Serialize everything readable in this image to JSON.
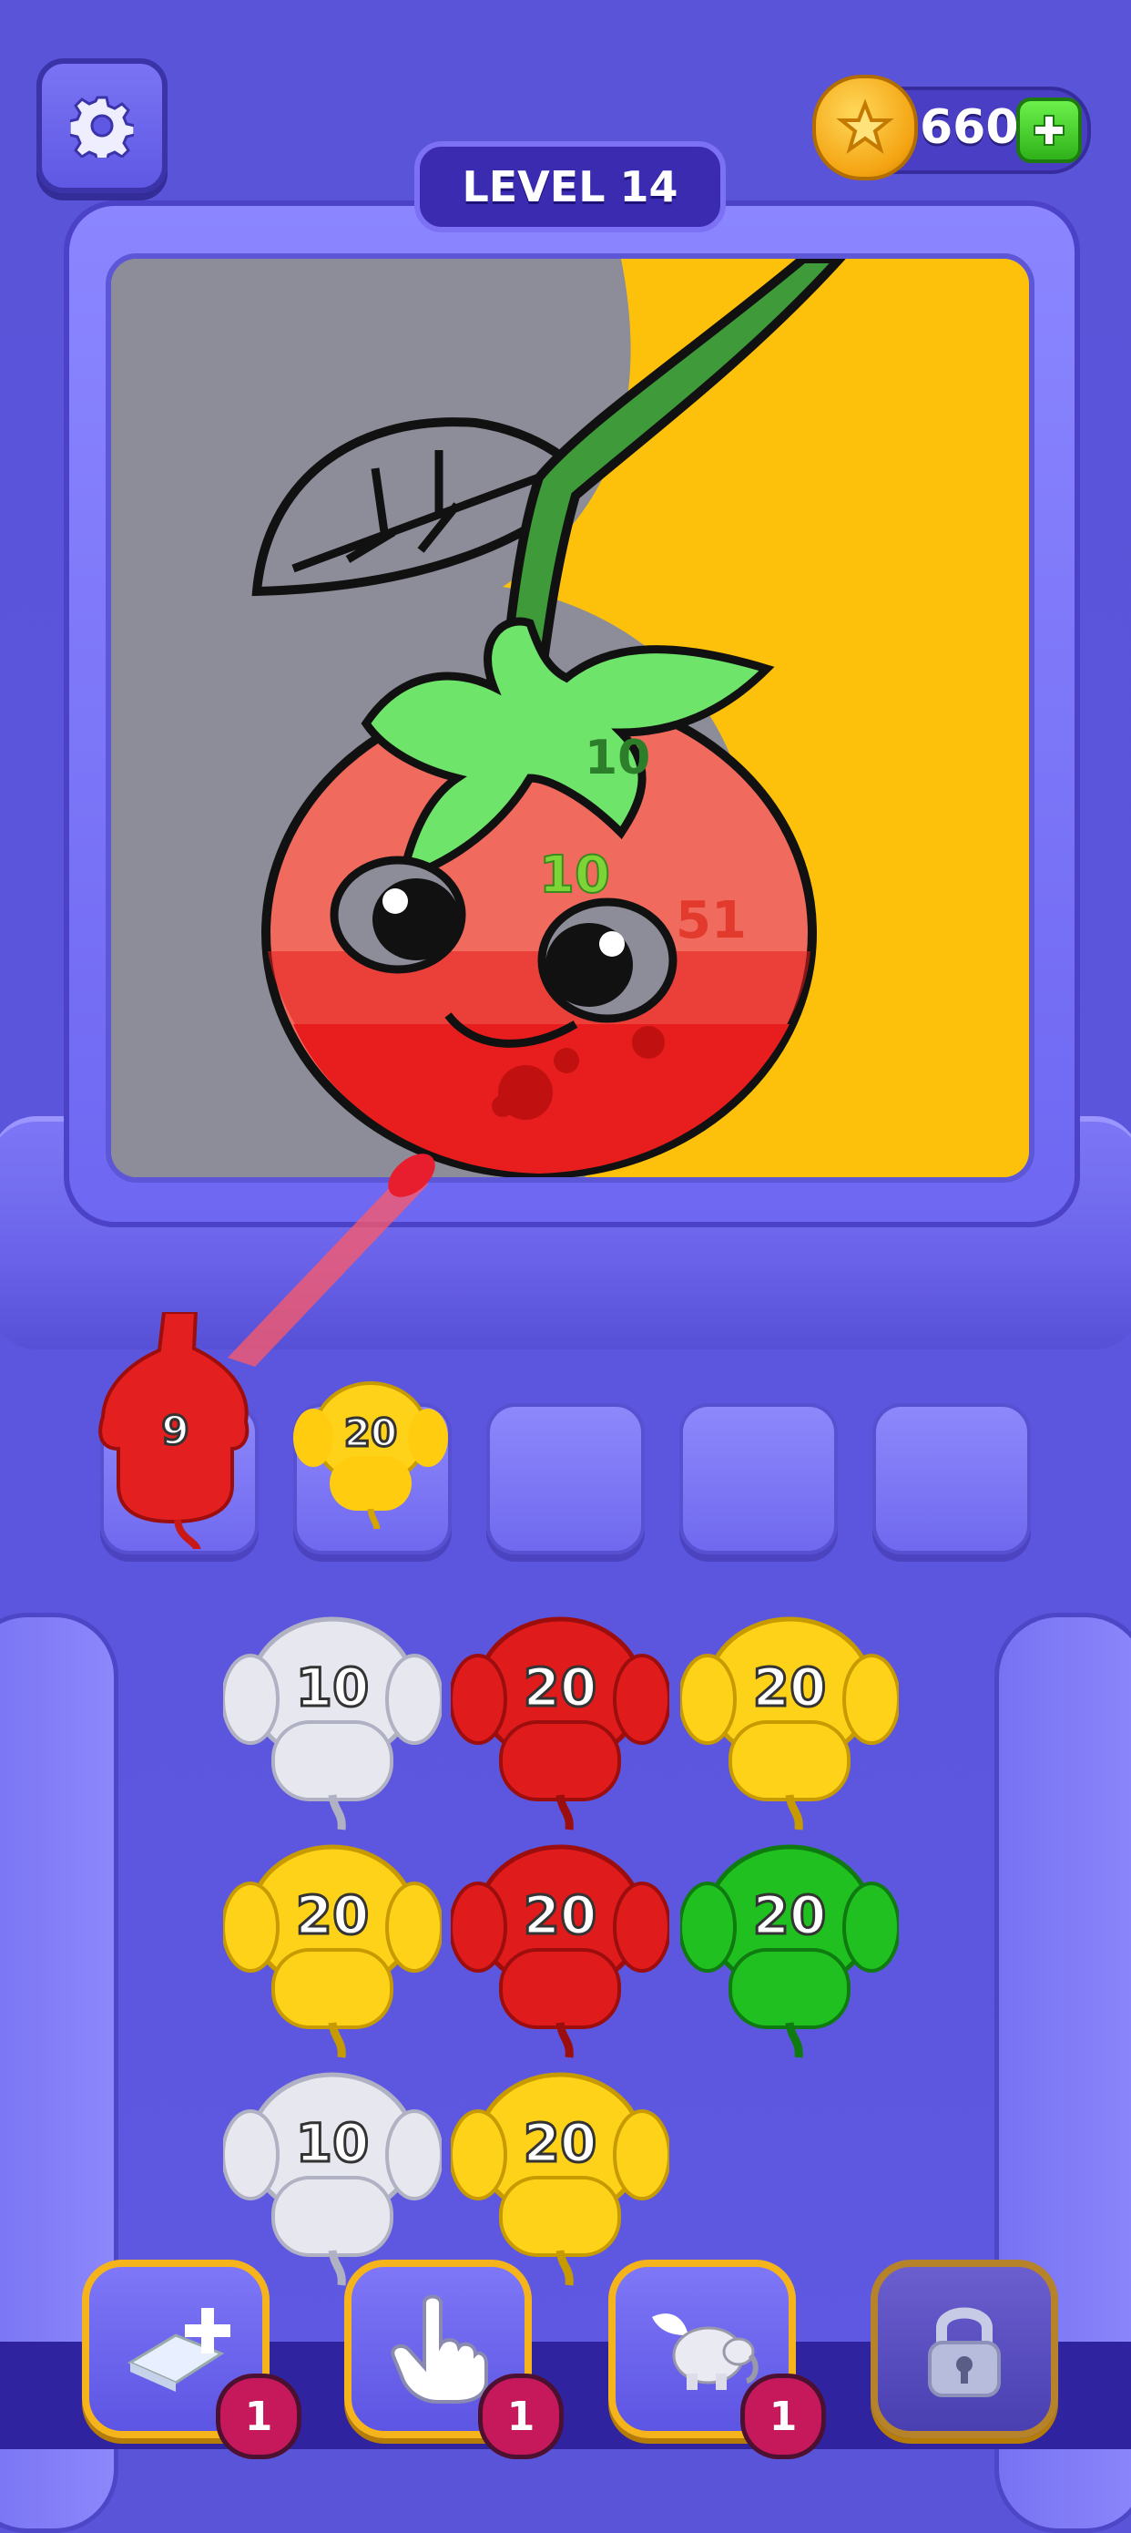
{
  "header": {
    "settings_icon": "gear-icon",
    "coins": "660",
    "coin_icon": "star-coin-icon",
    "add_coins_icon": "plus-icon",
    "level_label": "LEVEL 14"
  },
  "canvas": {
    "region_counts": [
      "10",
      "10",
      "51"
    ],
    "colors": {
      "background_left": "#8d8c99",
      "background_right": "#fec10b",
      "stem": "#3f9a3a",
      "leaf_top": "#6ee46a",
      "tomato": "#f06a5e",
      "paint_red": "#e81e1e"
    }
  },
  "active_slots": [
    {
      "color": "red",
      "count": "9"
    },
    {
      "color": "yellow",
      "count": "20"
    },
    {
      "empty": true
    },
    {
      "empty": true
    },
    {
      "empty": true
    }
  ],
  "queue": [
    {
      "color": "white",
      "count": "10"
    },
    {
      "color": "red",
      "count": "20"
    },
    {
      "color": "yellow",
      "count": "20"
    },
    {
      "color": "yellow",
      "count": "20"
    },
    {
      "color": "red",
      "count": "20"
    },
    {
      "color": "green",
      "count": "20"
    },
    {
      "color": "white",
      "count": "10"
    },
    {
      "color": "yellow",
      "count": "20"
    }
  ],
  "powerups": [
    {
      "name": "add-slot",
      "icon": "card-plus-icon",
      "count": "1"
    },
    {
      "name": "tap",
      "icon": "pointing-hand-icon",
      "count": "1"
    },
    {
      "name": "fly",
      "icon": "winged-elephant-icon",
      "count": "1"
    },
    {
      "name": "locked",
      "icon": "padlock-icon"
    }
  ]
}
